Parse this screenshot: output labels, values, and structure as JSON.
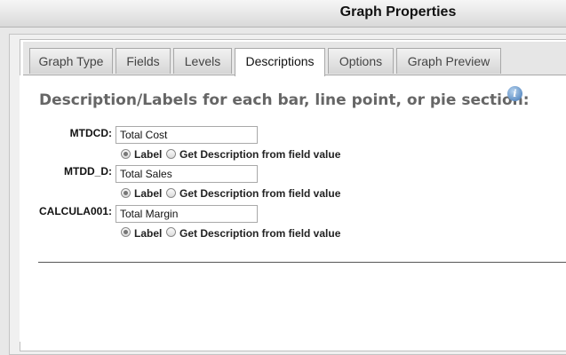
{
  "window": {
    "title": "Graph Properties"
  },
  "tabs": [
    {
      "label": "Graph Type"
    },
    {
      "label": "Fields"
    },
    {
      "label": "Levels"
    },
    {
      "label": "Descriptions"
    },
    {
      "label": "Options"
    },
    {
      "label": "Graph Preview"
    }
  ],
  "active_tab": "Descriptions",
  "heading": "Description/Labels for each bar, line point, or pie section:",
  "fields": [
    {
      "name": "MTDCD:",
      "value": "Total Cost",
      "label_option": "Label",
      "field_option": "Get Description from field value",
      "selected": "Label"
    },
    {
      "name": "MTDD_D:",
      "value": "Total Sales",
      "label_option": "Label",
      "field_option": "Get Description from field value",
      "selected": "Label"
    },
    {
      "name": "CALCULA001:",
      "value": "Total Margin",
      "label_option": "Label",
      "field_option": "Get Description from field value",
      "selected": "Label"
    }
  ]
}
